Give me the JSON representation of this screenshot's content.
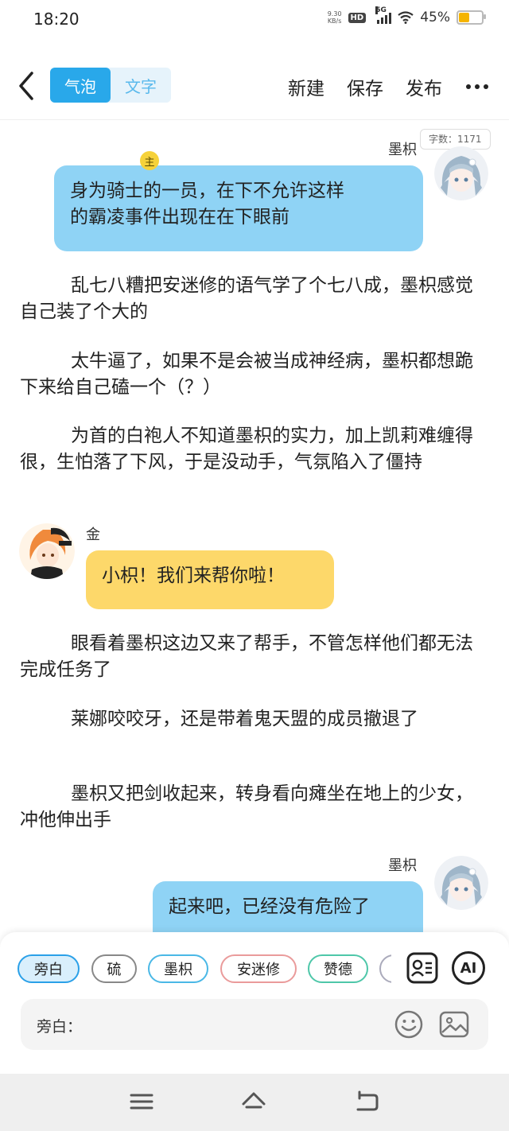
{
  "status_bar": {
    "time": "18:20",
    "net_speed_value": "9.30",
    "net_speed_unit": "KB/s",
    "hd": "HD",
    "network": "5G",
    "battery": "45%",
    "battery_level": 0.45
  },
  "header": {
    "tabs": [
      {
        "label": "气泡",
        "active": true
      },
      {
        "label": "文字",
        "active": false
      }
    ],
    "new_label": "新建",
    "save_label": "保存",
    "publish_label": "发布"
  },
  "word_count": "字数：1171",
  "messages": [
    {
      "type": "bubble",
      "side": "right",
      "speaker": "墨枳",
      "lines": [
        "身为骑士的一员，在下不允许这样",
        "的霸凌事件出现在在下眼前"
      ]
    },
    {
      "type": "narration",
      "text": "乱七八糟把安迷修的语气学了个七八成，墨枳感觉自己装了个大的"
    },
    {
      "type": "narration",
      "text": "太牛逼了，如果不是会被当成神经病，墨枳都想跪下来给自己磕一个（？）"
    },
    {
      "type": "narration",
      "text": "为首的白袍人不知道墨枳的实力，加上凯莉难缠得很，生怕落了下风，于是没动手，气氛陷入了僵持"
    },
    {
      "type": "bubble",
      "side": "left",
      "speaker": "金",
      "lines": [
        "小枳！我们来帮你啦！"
      ]
    },
    {
      "type": "narration",
      "text": "眼看着墨枳这边又来了帮手，不管怎样他们都无法完成任务了"
    },
    {
      "type": "narration",
      "text": "莱娜咬咬牙，还是带着鬼天盟的成员撤退了"
    },
    {
      "type": "narration",
      "text": "墨枳又把剑收起来，转身看向瘫坐在地上的少女，冲他伸出手"
    },
    {
      "type": "bubble",
      "side": "right",
      "speaker": "墨枳",
      "lines": [
        "起来吧，已经没有危险了"
      ]
    }
  ],
  "characters": [
    {
      "label": "旁白",
      "active": true
    },
    {
      "label": "硫",
      "active": false
    },
    {
      "label": "墨枳",
      "active": false,
      "badge": "主"
    },
    {
      "label": "安迷修",
      "active": false
    },
    {
      "label": "赞德",
      "active": false
    }
  ],
  "ai_label": "AI",
  "input": {
    "label": "旁白：",
    "value": ""
  },
  "colors": {
    "accent": "#29a8ea",
    "bubble_right": "#8fd3f5",
    "bubble_left": "#fdd86a"
  }
}
